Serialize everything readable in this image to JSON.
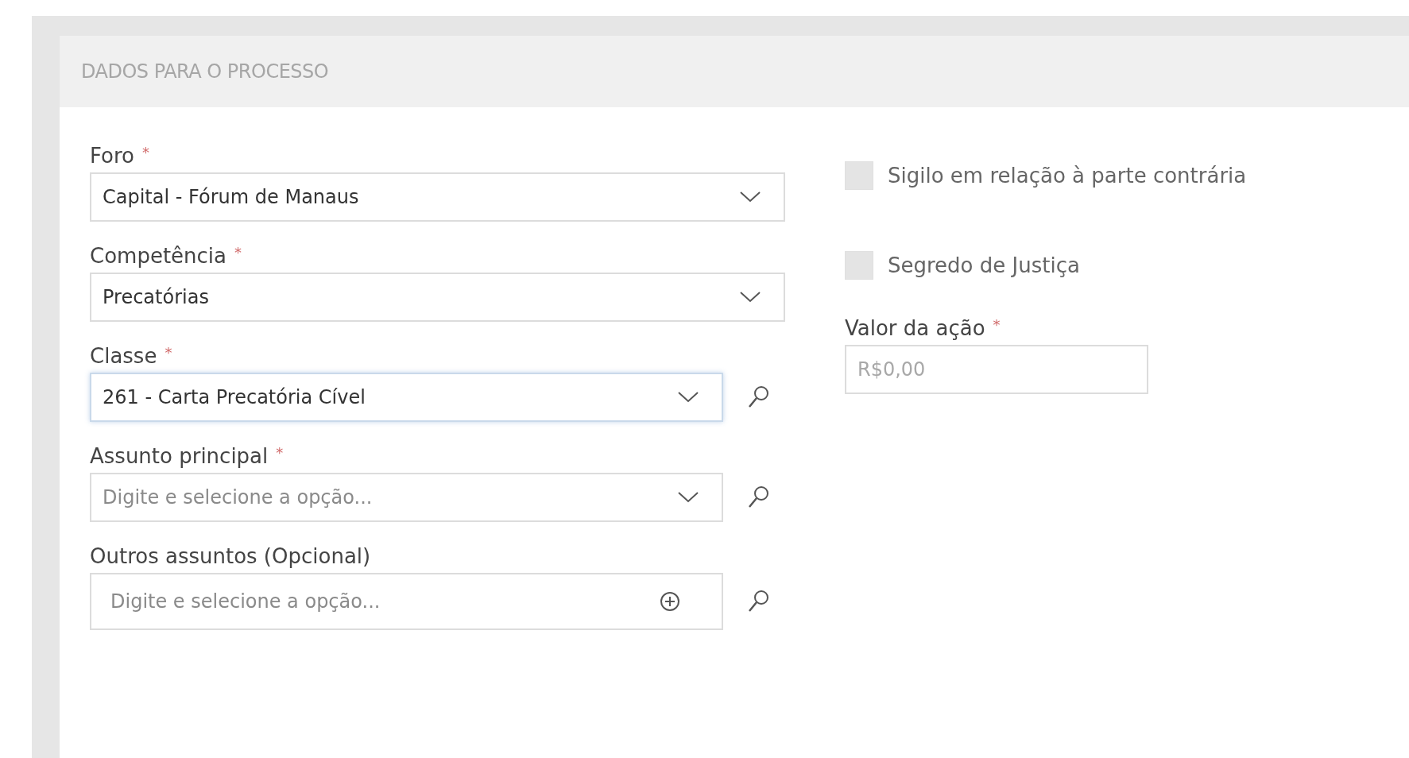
{
  "section": {
    "title": "DADOS PARA O PROCESSO"
  },
  "fields": [
    {
      "kind": "dropdown",
      "label": "Foro",
      "mark": "*",
      "value": "Capital - Fórum de Manaus",
      "focused": false,
      "search": false
    },
    {
      "kind": "dropdown",
      "label": "Competência",
      "mark": "*",
      "value": "Precatórias",
      "focused": false,
      "search": false
    },
    {
      "kind": "dropdown",
      "label": "Classe",
      "mark": "*",
      "value": "261 - Carta Precatória Cível",
      "focused": true,
      "search": true
    },
    {
      "kind": "dropdown",
      "label": "Assunto principal",
      "mark": "*",
      "placeholder": "Digite e selecione a opção...",
      "focused": false,
      "search": true
    },
    {
      "kind": "add",
      "label": "Outros assuntos (Opcional)",
      "placeholder": "Digite e selecione a opção...",
      "focused": false,
      "search": true
    }
  ],
  "options": [
    {
      "label": "Sigilo em relação à parte contrária",
      "checked": false
    },
    {
      "label": "Segredo de Justiça",
      "checked": false
    }
  ],
  "amount": {
    "label": "Valor da ação",
    "mark": "*",
    "placeholder": "R$0,00"
  }
}
